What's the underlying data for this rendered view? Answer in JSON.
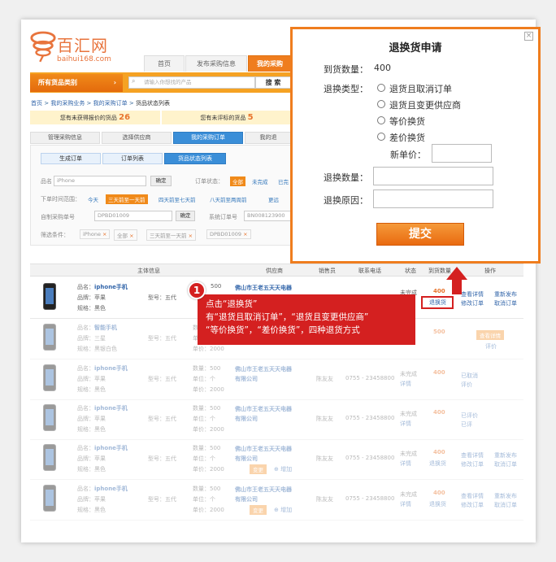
{
  "header": {
    "logo_text": "百汇网",
    "logo_url": "baihui168.com",
    "nav_tabs": [
      "首页",
      "发布采购信息",
      "我的采购"
    ]
  },
  "searchbar": {
    "category_button": "所有货品类别",
    "placeholder": "请输入你想找的产品",
    "search_button": "搜 索"
  },
  "breadcrumb": {
    "items": [
      "首页",
      "我的采购业务",
      "我的采购订单"
    ],
    "current": "货品状态列表"
  },
  "notices": [
    {
      "label": "您有未获得报价的货品",
      "count": "26"
    },
    {
      "label": "您有未评标的货品",
      "count": "5"
    }
  ],
  "main_tabs": [
    "管理采购信息",
    "选择供应商",
    "我的采购订单",
    "我的退"
  ],
  "sub_tabs": [
    "生成订单",
    "订单列表",
    "货品状态列表"
  ],
  "filters": {
    "name_label": "品名",
    "name_value": "iPhone",
    "confirm": "确定",
    "status_label": "订单状态：",
    "status_options": [
      "全部",
      "未完成",
      "已完"
    ],
    "time_label": "下单时间范围：",
    "time_options": [
      "今天",
      "三天前至一天前",
      "四天前至七天前",
      "八天前至两周前",
      "更远"
    ],
    "self_no_label": "自制采购单号",
    "self_no_value": "DPBD01009",
    "sys_no_label": "系统订单号",
    "sys_no_value": "BN008123900",
    "chosen_label": "筛选条件：",
    "chosen": [
      "iPhone",
      "全部",
      "三天前至一天前",
      "DPBD01009"
    ]
  },
  "table": {
    "headers": [
      "主体信息",
      "供应商",
      "销售员",
      "联系电话",
      "状态",
      "到货数量",
      "操作"
    ],
    "rows": [
      {
        "name": "iphone手机",
        "brand": "苹果",
        "spec": "黑色",
        "model": "五代",
        "count": "500",
        "unit": "个",
        "price": "2000",
        "supplier": "佛山市王老五天天电器有限公司",
        "seller": "陈友友",
        "phone": "0755 - 23458800",
        "status": "未完成",
        "status2": "详情",
        "qty": "400",
        "qty_action": "退换货",
        "op1": "查看详情",
        "op2": "修改订单",
        "op3": "重新发布",
        "op4": "取消订单"
      },
      {
        "name": "智能手机",
        "brand": "三星",
        "spec": "黑银白色",
        "model": "五代",
        "count": "500",
        "unit": "个",
        "price": "2000",
        "supplier": "",
        "seller": "",
        "phone": "",
        "status": "",
        "status2": "",
        "qty": "500",
        "qty_action": "",
        "op1": "查看详情",
        "op2": "评价",
        "op3": "",
        "op4": ""
      },
      {
        "name": "iphone手机",
        "brand": "苹果",
        "spec": "黑色",
        "model": "五代",
        "count": "500",
        "unit": "个",
        "price": "2000",
        "supplier": "佛山市王老五天天电器有限公司",
        "seller": "陈友友",
        "phone": "0755 - 23458800",
        "status": "未完成",
        "status2": "详情",
        "qty": "400",
        "qty_action": "",
        "op1": "已取消",
        "op2": "评价",
        "op3": "",
        "op4": ""
      },
      {
        "name": "iphone手机",
        "brand": "苹果",
        "spec": "黑色",
        "model": "五代",
        "count": "500",
        "unit": "个",
        "price": "2000",
        "supplier": "佛山市王老五天天电器有限公司",
        "seller": "陈友友",
        "phone": "0755 - 23458800",
        "status": "未完成",
        "status2": "详情",
        "qty": "400",
        "qty_action": "",
        "op1": "已评价",
        "op2": "已评",
        "op3": "",
        "op4": ""
      },
      {
        "name": "iphone手机",
        "brand": "苹果",
        "spec": "黑色",
        "model": "五代",
        "count": "500",
        "unit": "个",
        "price": "2000",
        "supplier": "佛山市王老五天天电器有限公司",
        "seller": "陈友友",
        "phone": "0755 - 23458800",
        "status": "未完成",
        "status2": "详情",
        "qty": "400",
        "qty_action": "退换货",
        "op1": "查看详情",
        "op2": "修改订单",
        "op3": "重新发布",
        "op4": "取消订单",
        "change": "变更",
        "add": "增加"
      },
      {
        "name": "iphone手机",
        "brand": "苹果",
        "spec": "黑色",
        "model": "五代",
        "count": "500",
        "unit": "个",
        "price": "2000",
        "supplier": "佛山市王老五天天电器有限公司",
        "seller": "陈友友",
        "phone": "0755 - 23458800",
        "status": "未完成",
        "status2": "详情",
        "qty": "400",
        "qty_action": "退换货",
        "op1": "查看详情",
        "op2": "修改订单",
        "op3": "重新发布",
        "op4": "取消订单",
        "change": "变更",
        "add": "增加"
      }
    ],
    "field_labels": {
      "name": "品名：",
      "brand": "品牌：",
      "spec": "规格：",
      "model": "型号：",
      "count": "数量：",
      "unit": "单位：",
      "price": "单价："
    }
  },
  "dialog": {
    "title": "退换货申请",
    "arrived_label": "到货数量：",
    "arrived_value": "400",
    "type_label": "退换类型：",
    "options": [
      "退货且取消订单",
      "退货且变更供应商",
      "等价换货",
      "差价换货"
    ],
    "new_price_label": "新单价：",
    "qty_label": "退换数量：",
    "reason_label": "退换原因：",
    "submit": "提交",
    "close": "×"
  },
  "callout": {
    "number": "1",
    "line1": "点击“退换货”",
    "line2": "有“退货且取消订单”，“退货且变更供应商”",
    "line3": "“等价换货”，“差价换货”，四种退货方式"
  },
  "colors": {
    "accent": "#ef7d1e",
    "link": "#3366aa",
    "callout": "#d42020",
    "tab_blue": "#3a8ed8"
  }
}
